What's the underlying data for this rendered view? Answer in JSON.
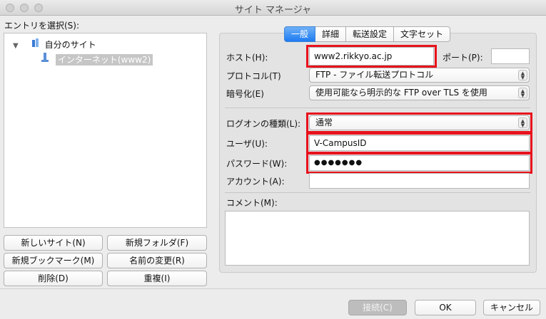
{
  "window": {
    "title": "サイト マネージャ"
  },
  "left": {
    "select_label": "エントリを選択(S):",
    "tree": {
      "root": "自分のサイト",
      "child": "インターネット(www2)"
    },
    "buttons": {
      "new_site": "新しいサイト(N)",
      "new_folder": "新規フォルダ(F)",
      "new_bookmark": "新規ブックマーク(M)",
      "rename": "名前の変更(R)",
      "delete": "削除(D)",
      "duplicate": "重複(I)"
    }
  },
  "tabs": [
    "一般",
    "詳細",
    "転送設定",
    "文字セット"
  ],
  "form": {
    "host_label": "ホスト(H):",
    "host_value": "www2.rikkyo.ac.jp",
    "port_label": "ポート(P):",
    "port_value": "",
    "protocol_label": "プロトコル(T)",
    "protocol_value": "FTP - ファイル転送プロトコル",
    "encryption_label": "暗号化(E)",
    "encryption_value": "使用可能なら明示的な FTP over TLS を使用",
    "logon_label": "ログオンの種類(L):",
    "logon_value": "通常",
    "user_label": "ユーザ(U):",
    "user_value": "V-CampusID",
    "password_label": "パスワード(W):",
    "password_value": "●●●●●●●",
    "account_label": "アカウント(A):",
    "account_value": "",
    "comment_label": "コメント(M):",
    "comment_value": ""
  },
  "footer": {
    "connect": "接続(C)",
    "ok": "OK",
    "cancel": "キャンセル"
  },
  "colors": {
    "highlight": "#e8121c",
    "tab_selected": "#1e7bf2",
    "tree_selection": "#c6c6c6"
  }
}
